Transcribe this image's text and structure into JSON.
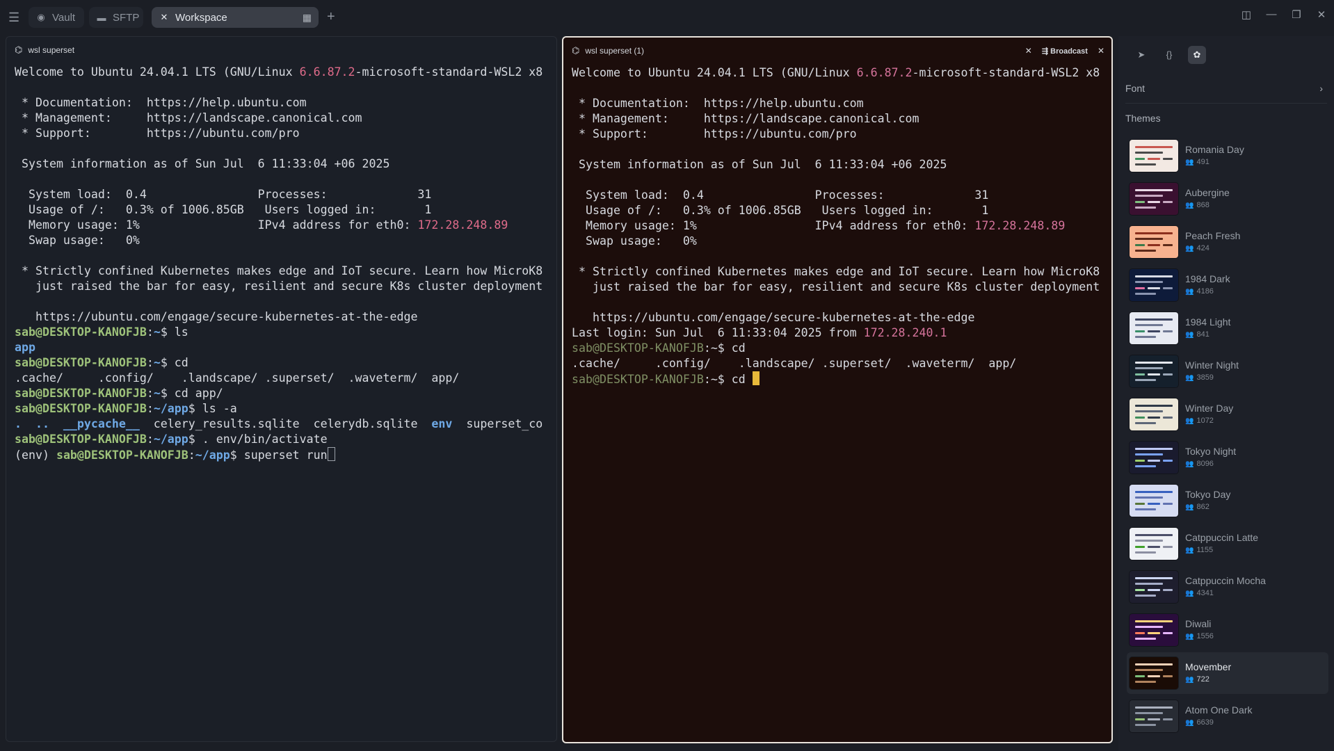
{
  "tabs": [
    {
      "label": "Vault",
      "icon": "vault-icon"
    },
    {
      "label": "SFTP",
      "icon": "folder-icon"
    },
    {
      "label": "Workspace",
      "icon": "close-icon"
    }
  ],
  "left_pane": {
    "title": "wsl superset",
    "lines": [
      [
        {
          "t": "Welcome to Ubuntu 24.04.1 LTS (GNU/Linux "
        },
        {
          "t": "6.6.87.2",
          "c": "ip"
        },
        {
          "t": "-microsoft-standard-WSL2 x8"
        }
      ],
      [],
      [
        {
          "t": " * Documentation:  https://help.ubuntu.com"
        }
      ],
      [
        {
          "t": " * Management:     https://landscape.canonical.com"
        }
      ],
      [
        {
          "t": " * Support:        https://ubuntu.com/pro"
        }
      ],
      [],
      [
        {
          "t": " System information as of Sun Jul  6 11:33:04 +06 2025"
        }
      ],
      [],
      [
        {
          "t": "  System load:  0.4                Processes:             31"
        }
      ],
      [
        {
          "t": "  Usage of /:   0.3% of 1006.85GB   Users logged in:       1"
        }
      ],
      [
        {
          "t": "  Memory usage: 1%                 IPv4 address for eth0: "
        },
        {
          "t": "172.28.248.89",
          "c": "ip"
        }
      ],
      [
        {
          "t": "  Swap usage:   0%"
        }
      ],
      [],
      [
        {
          "t": " * Strictly confined Kubernetes makes edge and IoT secure. Learn how MicroK8"
        }
      ],
      [
        {
          "t": "   just raised the bar for easy, resilient and secure K8s cluster deployment"
        }
      ],
      [],
      [
        {
          "t": "   https://ubuntu.com/engage/secure-kubernetes-at-the-edge"
        }
      ],
      [
        {
          "t": "sab@DESKTOP-KANOFJB",
          "c": "pg"
        },
        {
          "t": ":"
        },
        {
          "t": "~",
          "c": "path"
        },
        {
          "t": "$ ls"
        }
      ],
      [
        {
          "t": "app",
          "c": "dir"
        }
      ],
      [
        {
          "t": "sab@DESKTOP-KANOFJB",
          "c": "pg"
        },
        {
          "t": ":"
        },
        {
          "t": "~",
          "c": "path"
        },
        {
          "t": "$ cd"
        }
      ],
      [
        {
          "t": ".cache/     .config/    .landscape/ .superset/  .waveterm/  app/"
        }
      ],
      [
        {
          "t": "sab@DESKTOP-KANOFJB",
          "c": "pg"
        },
        {
          "t": ":"
        },
        {
          "t": "~",
          "c": "path"
        },
        {
          "t": "$ cd app/"
        }
      ],
      [
        {
          "t": "sab@DESKTOP-KANOFJB",
          "c": "pg"
        },
        {
          "t": ":"
        },
        {
          "t": "~/app",
          "c": "path"
        },
        {
          "t": "$ ls -a"
        }
      ],
      [
        {
          "t": ".  ..  __pycache__",
          "c": "dir"
        },
        {
          "t": "  celery_results.sqlite  celerydb.sqlite  "
        },
        {
          "t": "env",
          "c": "dir"
        },
        {
          "t": "  superset_co"
        }
      ],
      [
        {
          "t": "sab@DESKTOP-KANOFJB",
          "c": "pg"
        },
        {
          "t": ":"
        },
        {
          "t": "~/app",
          "c": "path"
        },
        {
          "t": "$ . env/bin/activate"
        }
      ],
      [
        {
          "t": "(env) "
        },
        {
          "t": "sab@DESKTOP-KANOFJB",
          "c": "pg"
        },
        {
          "t": ":"
        },
        {
          "t": "~/app",
          "c": "path"
        },
        {
          "t": "$ superset run"
        },
        {
          "cursor": "hollow"
        }
      ]
    ]
  },
  "right_pane": {
    "title": "wsl superset (1)",
    "broadcast_label": "Broadcast",
    "lines": [
      [
        {
          "t": "Welcome to Ubuntu 24.04.1 LTS (GNU/Linux "
        },
        {
          "t": "6.6.87.2",
          "c": "ip"
        },
        {
          "t": "-microsoft-standard-WSL2 x8"
        }
      ],
      [],
      [
        {
          "t": " * Documentation:  https://help.ubuntu.com"
        }
      ],
      [
        {
          "t": " * Management:     https://landscape.canonical.com"
        }
      ],
      [
        {
          "t": " * Support:        https://ubuntu.com/pro"
        }
      ],
      [],
      [
        {
          "t": " System information as of Sun Jul  6 11:33:04 +06 2025"
        }
      ],
      [],
      [
        {
          "t": "  System load:  0.4                Processes:             31"
        }
      ],
      [
        {
          "t": "  Usage of /:   0.3% of 1006.85GB   Users logged in:       1"
        }
      ],
      [
        {
          "t": "  Memory usage: 1%                 IPv4 address for eth0: "
        },
        {
          "t": "172.28.248.89",
          "c": "ip"
        }
      ],
      [
        {
          "t": "  Swap usage:   0%"
        }
      ],
      [],
      [
        {
          "t": " * Strictly confined Kubernetes makes edge and IoT secure. Learn how MicroK8"
        }
      ],
      [
        {
          "t": "   just raised the bar for easy, resilient and secure K8s cluster deployment"
        }
      ],
      [],
      [
        {
          "t": "   https://ubuntu.com/engage/secure-kubernetes-at-the-edge"
        }
      ],
      [
        {
          "t": "Last login: Sun Jul  6 11:33:04 2025 from "
        },
        {
          "t": "172.28.240.1",
          "c": "ip"
        }
      ],
      [
        {
          "t": "sab@DESKTOP-KANOFJB",
          "c": "pg"
        },
        {
          "t": ":~$ cd"
        }
      ],
      [
        {
          "t": ".cache/     .config/    .landscape/ .superset/  .waveterm/  app/"
        }
      ],
      [
        {
          "t": "sab@DESKTOP-KANOFJB",
          "c": "pg"
        },
        {
          "t": ":~$ cd "
        },
        {
          "cursor": "block"
        }
      ]
    ]
  },
  "side_panel": {
    "font_label": "Font",
    "themes_label": "Themes",
    "themes": [
      {
        "name": "Romania Day",
        "count": "491",
        "bg": "#f3e9e3",
        "c1": "#c8574f",
        "c2": "#4a4a4a",
        "c3": "#3f8f5b"
      },
      {
        "name": "Aubergine",
        "count": "868",
        "bg": "#3a1030",
        "c1": "#e9d8e6",
        "c2": "#c9aac3",
        "c3": "#7fbf7f"
      },
      {
        "name": "Peach Fresh",
        "count": "424",
        "bg": "#f7b28f",
        "c1": "#8c2f1d",
        "c2": "#5d2a1a",
        "c3": "#3b7a4a"
      },
      {
        "name": "1984 Dark",
        "count": "4186",
        "bg": "#0e1b3a",
        "c1": "#d9dce5",
        "c2": "#8a94b0",
        "c3": "#e26fa2"
      },
      {
        "name": "1984 Light",
        "count": "841",
        "bg": "#e7eaf2",
        "c1": "#3c4460",
        "c2": "#6f7894",
        "c3": "#3a8f6a"
      },
      {
        "name": "Winter Night",
        "count": "3859",
        "bg": "#15202c",
        "c1": "#e3e7ee",
        "c2": "#9aa7b8",
        "c3": "#7fc0a0"
      },
      {
        "name": "Winter Day",
        "count": "1072",
        "bg": "#ece7d8",
        "c1": "#2f3a48",
        "c2": "#5d6777",
        "c3": "#3f8f5b"
      },
      {
        "name": "Tokyo Night",
        "count": "8096",
        "bg": "#1a1b2e",
        "c1": "#c0caf5",
        "c2": "#7aa2f7",
        "c3": "#9ece6a"
      },
      {
        "name": "Tokyo Day",
        "count": "862",
        "bg": "#d6dcf2",
        "c1": "#3760bf",
        "c2": "#6172b0",
        "c3": "#587539"
      },
      {
        "name": "Catppuccin Latte",
        "count": "1155",
        "bg": "#eff1f5",
        "c1": "#4c4f69",
        "c2": "#8c8fa1",
        "c3": "#40a02b"
      },
      {
        "name": "Catppuccin Mocha",
        "count": "4341",
        "bg": "#1e1e2e",
        "c1": "#cdd6f4",
        "c2": "#a6adc8",
        "c3": "#a6e3a1"
      },
      {
        "name": "Diwali",
        "count": "1556",
        "bg": "#2a0d3c",
        "c1": "#ffd27a",
        "c2": "#e6b6ff",
        "c3": "#ff7a5c"
      },
      {
        "name": "Movember",
        "count": "722",
        "bg": "#1a0c06",
        "c1": "#f3d2b8",
        "c2": "#b0835e",
        "c3": "#7cbf7a",
        "selected": true
      },
      {
        "name": "Atom One Dark",
        "count": "6639",
        "bg": "#282c34",
        "c1": "#abb2bf",
        "c2": "#8b93a1",
        "c3": "#98c379"
      }
    ]
  }
}
